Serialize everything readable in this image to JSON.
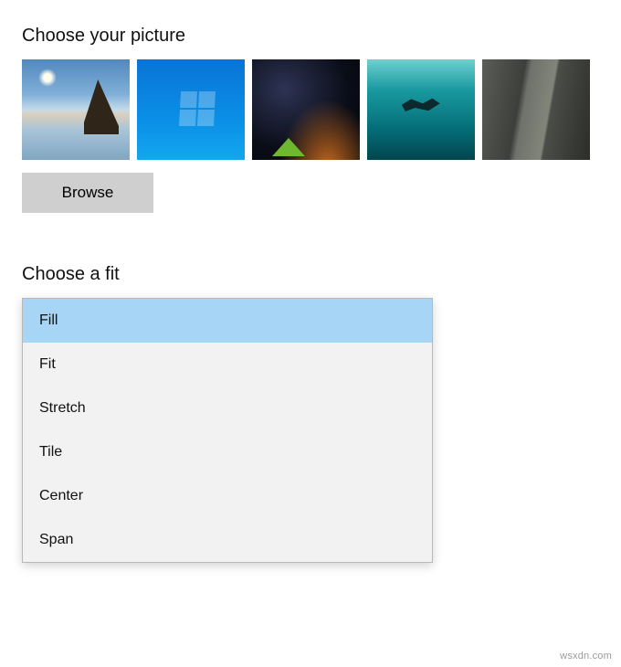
{
  "picture_section": {
    "title": "Choose your picture",
    "thumbnails": [
      {
        "name": "beach-rock-sunset"
      },
      {
        "name": "windows-10-blue"
      },
      {
        "name": "night-sky-tent"
      },
      {
        "name": "underwater-swimmer"
      },
      {
        "name": "rocky-cliff"
      }
    ],
    "browse_label": "Browse"
  },
  "fit_section": {
    "title": "Choose a fit",
    "options": [
      {
        "label": "Fill",
        "selected": true
      },
      {
        "label": "Fit",
        "selected": false
      },
      {
        "label": "Stretch",
        "selected": false
      },
      {
        "label": "Tile",
        "selected": false
      },
      {
        "label": "Center",
        "selected": false
      },
      {
        "label": "Span",
        "selected": false
      }
    ]
  },
  "watermark": "wsxdn.com"
}
